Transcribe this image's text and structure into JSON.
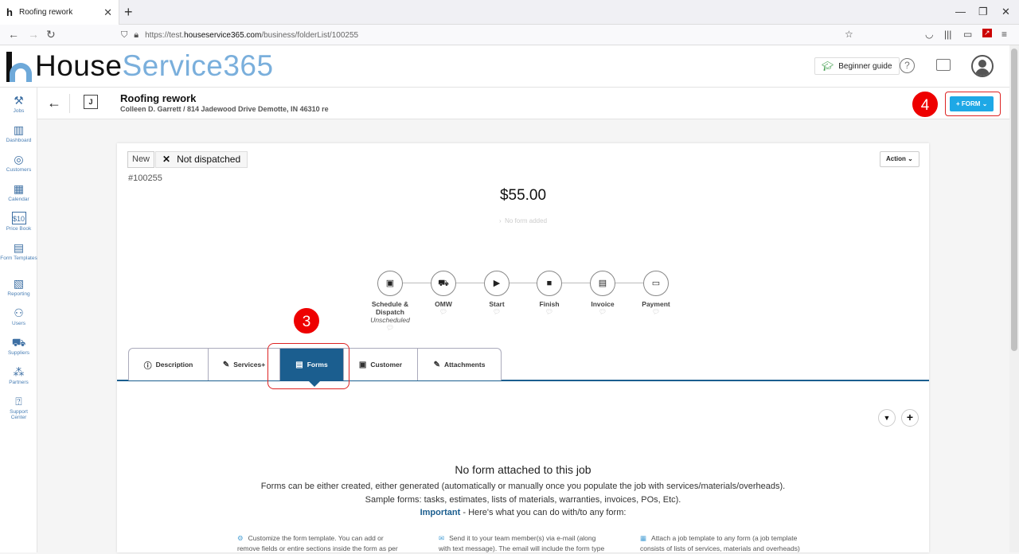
{
  "browser": {
    "tab_title": "Roofing rework",
    "url_prefix": "https://test.",
    "url_host": "houseservice365.com",
    "url_path": "/business/folderList/100255"
  },
  "header": {
    "logo_part1": "House",
    "logo_part2": "Service365",
    "beginner_guide": "Beginner guide",
    "help_symbol": "?"
  },
  "sidebar": {
    "items": [
      {
        "label": "Jobs",
        "icon": "tools-icon"
      },
      {
        "label": "Dashboard",
        "icon": "chart-icon"
      },
      {
        "label": "Customers",
        "icon": "target-icon"
      },
      {
        "label": "Calendar",
        "icon": "calendar-icon"
      },
      {
        "label": "Price Book",
        "icon": "price-icon"
      },
      {
        "label": "Form Templates",
        "icon": "form-icon"
      },
      {
        "label": "Reporting",
        "icon": "report-icon"
      },
      {
        "label": "Users",
        "icon": "users-icon"
      },
      {
        "label": "Suppliers",
        "icon": "truck-icon"
      },
      {
        "label": "Partners",
        "icon": "partners-icon"
      },
      {
        "label": "Support Center",
        "icon": "support-icon"
      }
    ]
  },
  "job": {
    "badge": "J",
    "title": "Roofing rework",
    "subtitle": "Colleen D. Garrett / 814 Jadewood Drive Demotte, IN 46310 re",
    "form_button": "+ FORM",
    "status_new": "New",
    "status_dispatch": "Not dispatched",
    "number": "#100255",
    "action_button": "Action",
    "amount": "$55.00",
    "no_form_added": "No form added"
  },
  "steps": [
    {
      "label": "Schedule & Dispatch",
      "sub": "Unscheduled"
    },
    {
      "label": "OMW",
      "sub": ""
    },
    {
      "label": "Start",
      "sub": ""
    },
    {
      "label": "Finish",
      "sub": ""
    },
    {
      "label": "Invoice",
      "sub": ""
    },
    {
      "label": "Payment",
      "sub": ""
    }
  ],
  "tabs": [
    {
      "label": "Description",
      "icon": "ⓘ"
    },
    {
      "label": "Services+",
      "icon": "✎"
    },
    {
      "label": "Forms",
      "icon": "▤"
    },
    {
      "label": "Customer",
      "icon": "▣"
    },
    {
      "label": "Attachments",
      "icon": "✎"
    }
  ],
  "annotations": {
    "forms_step": "3",
    "form_button_step": "4"
  },
  "empty_state": {
    "title": "No form attached to this job",
    "line1": "Forms can be either created, either generated (automatically or manually once you populate the job with services/materials/overheads).",
    "line2": "Sample forms: tasks, estimates, lists of materials, warranties, invoices, POs, Etc).",
    "important": "Important",
    "line3_rest": " - Here's what you can do with/to any form:",
    "tips": [
      {
        "line1": "Customize the form template. You can add or",
        "line2": "remove fields or entire sections inside the form as per"
      },
      {
        "line1": "Send it to your team member(s) via e-mail (along",
        "line2": "with text message). The email will include the form type"
      },
      {
        "line1": "Attach a job template to any form (a job template",
        "line2": "consists of lists of services, materials and overheads)"
      }
    ]
  },
  "colors": {
    "primary": "#1b5e8f",
    "accent": "#1ea8e6",
    "annotation": "#e00000"
  }
}
